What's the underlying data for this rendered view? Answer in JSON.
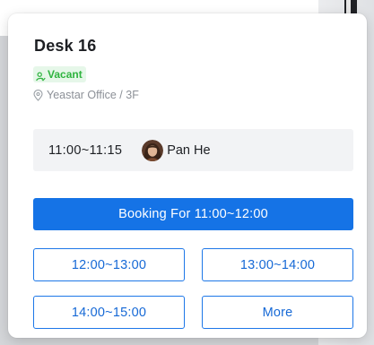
{
  "desk": {
    "title": "Desk 16",
    "status": "Vacant",
    "status_color": "#2fb43f",
    "status_icon": "person-check-icon",
    "location": "Yeastar Office / 3F",
    "location_icon": "location-pin-icon"
  },
  "current_booking": {
    "time": "11:00~11:15",
    "name": "Pan He"
  },
  "actions": {
    "primary_label": "Booking For 11:00~12:00",
    "primary_color": "#1573e6",
    "slots": [
      "12:00~13:00",
      "13:00~14:00",
      "14:00~15:00"
    ],
    "more_label": "More"
  }
}
